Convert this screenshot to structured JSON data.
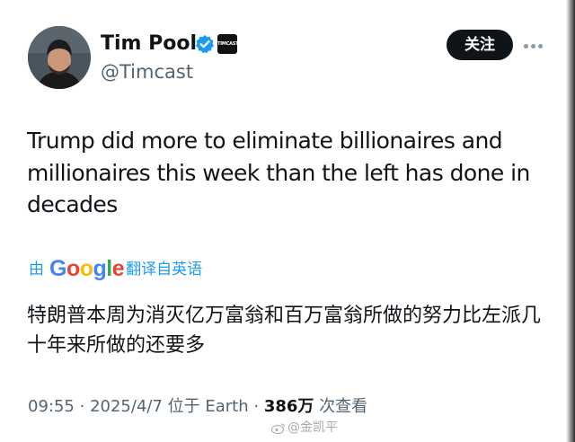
{
  "author": {
    "display_name": "Tim Pool",
    "handle": "@Timcast",
    "affiliate_badge_text": "TIMCAST",
    "verified_icon": "verified-badge-icon"
  },
  "actions": {
    "follow_label": "关注",
    "more_icon": "more-options-icon"
  },
  "tweet": {
    "text": "Trump did more to eliminate billionaires and millionaires this week than the left has done in decades"
  },
  "translation": {
    "prefix": "由",
    "provider": "Google",
    "suffix": "翻译自英语",
    "text": "特朗普本周为消灭亿万富翁和百万富翁所做的努力比左派几十年来所做的还要多"
  },
  "meta": {
    "time": "09:55",
    "date": "2025/4/7",
    "location": "位于 Earth",
    "views_count": "386万",
    "views_label": "次查看",
    "separator": "·"
  },
  "watermark": {
    "text": "@金凯平"
  },
  "colors": {
    "accent": "#1d9bf0",
    "text": "#0f1419",
    "muted": "#536471",
    "follow_bg": "#0f1419"
  }
}
